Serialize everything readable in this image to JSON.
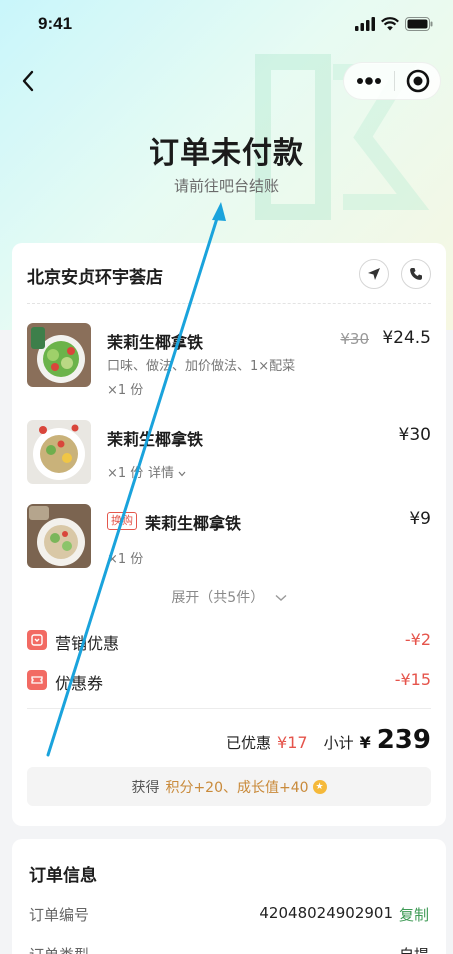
{
  "status_bar": {
    "time": "9:41"
  },
  "header": {
    "title": "订单未付款",
    "subtitle": "请前往吧台结账"
  },
  "store": {
    "name": "北京安贞环宇荟店"
  },
  "items": [
    {
      "name": "茉莉生椰拿铁",
      "spec": "口味、做法、加价做法、1×配菜",
      "qty": "×1 份",
      "old_price": "¥30",
      "price": "¥24.5"
    },
    {
      "name": "茉莉生椰拿铁",
      "qty": "×1 份",
      "detail": "详情",
      "price": "¥30"
    },
    {
      "tag": "换购",
      "name": "茉莉生椰拿铁",
      "qty": "×1 份",
      "price": "¥9"
    }
  ],
  "expand_label": "展开（共5件）",
  "promotions": [
    {
      "label": "营销优惠",
      "value": "-¥2"
    },
    {
      "label": "优惠券",
      "value": "-¥15"
    }
  ],
  "summary": {
    "discount_label": "已优惠",
    "discount_value": "¥17",
    "subtotal_label": "小计",
    "currency": "¥",
    "subtotal_value": "239"
  },
  "reward": {
    "prefix": "获得",
    "text": "积分+20、成长值+40"
  },
  "order_info": {
    "title": "订单信息",
    "rows": [
      {
        "label": "订单编号",
        "value": "42048024902901",
        "action": "复制"
      },
      {
        "label": "订单类型",
        "value": "自提"
      }
    ]
  },
  "colors": {
    "accent_red": "#e5544b",
    "copy_green": "#3e9a55",
    "reward_gold": "#c98a3a",
    "annotation_arrow": "#1aa3dc"
  }
}
